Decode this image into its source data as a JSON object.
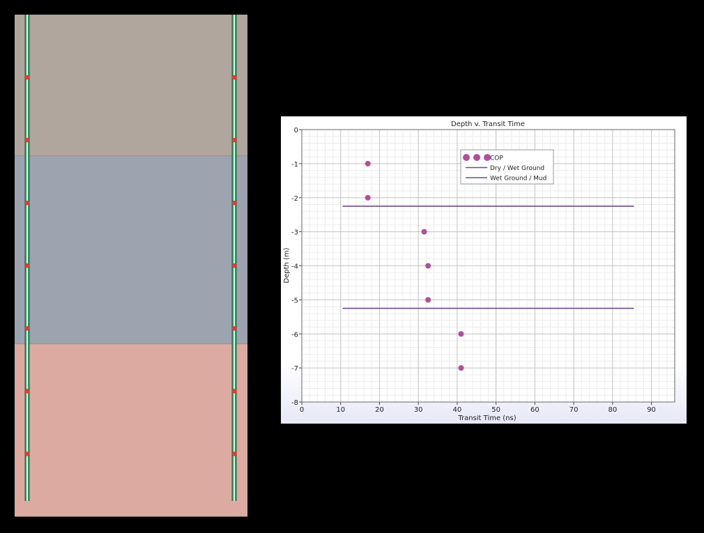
{
  "scene": {
    "layers": [
      {
        "name": "dry-ground",
        "color": "#b0a69e",
        "top_m": 0,
        "bottom_m": 2.25
      },
      {
        "name": "wet-ground",
        "color": "#9ea4af",
        "top_m": 2.25,
        "bottom_m": 5.25
      },
      {
        "name": "mud",
        "color": "#dcaaa0",
        "top_m": 5.25,
        "bottom_m": 8.0
      }
    ],
    "borehole_color": "#3e9e6a",
    "sensor_color": "#e03a33",
    "sensor_depths_m": [
      1,
      2,
      3,
      4,
      5,
      6,
      7
    ]
  },
  "chart_data": {
    "type": "scatter",
    "title": "Depth v. Transit Time",
    "xlabel": "Transit Time (ns)",
    "ylabel": "Depth (m)",
    "xlim": [
      0,
      96
    ],
    "ylim": [
      -8,
      0
    ],
    "xticks": [
      0,
      10,
      20,
      30,
      40,
      50,
      60,
      70,
      80,
      90
    ],
    "yticks": [
      0,
      -1,
      -2,
      -3,
      -4,
      -5,
      -6,
      -7,
      -8
    ],
    "grid": true,
    "legend_position": "top-center",
    "series": [
      {
        "name": "COP",
        "kind": "points",
        "color": "#b24f9a",
        "x": [
          17,
          17,
          31.5,
          32.5,
          32.5,
          41,
          41
        ],
        "y": [
          -1,
          -2,
          -3,
          -4,
          -5,
          -6,
          -7
        ]
      },
      {
        "name": "Dry / Wet Ground",
        "kind": "line",
        "color": "#6a4c8c",
        "x": [
          10.5,
          85.5
        ],
        "y": [
          -2.25,
          -2.25
        ]
      },
      {
        "name": "Wet Ground / Mud",
        "kind": "line",
        "color": "#6a4c8c",
        "x": [
          10.5,
          85.5
        ],
        "y": [
          -5.25,
          -5.25
        ]
      }
    ]
  }
}
